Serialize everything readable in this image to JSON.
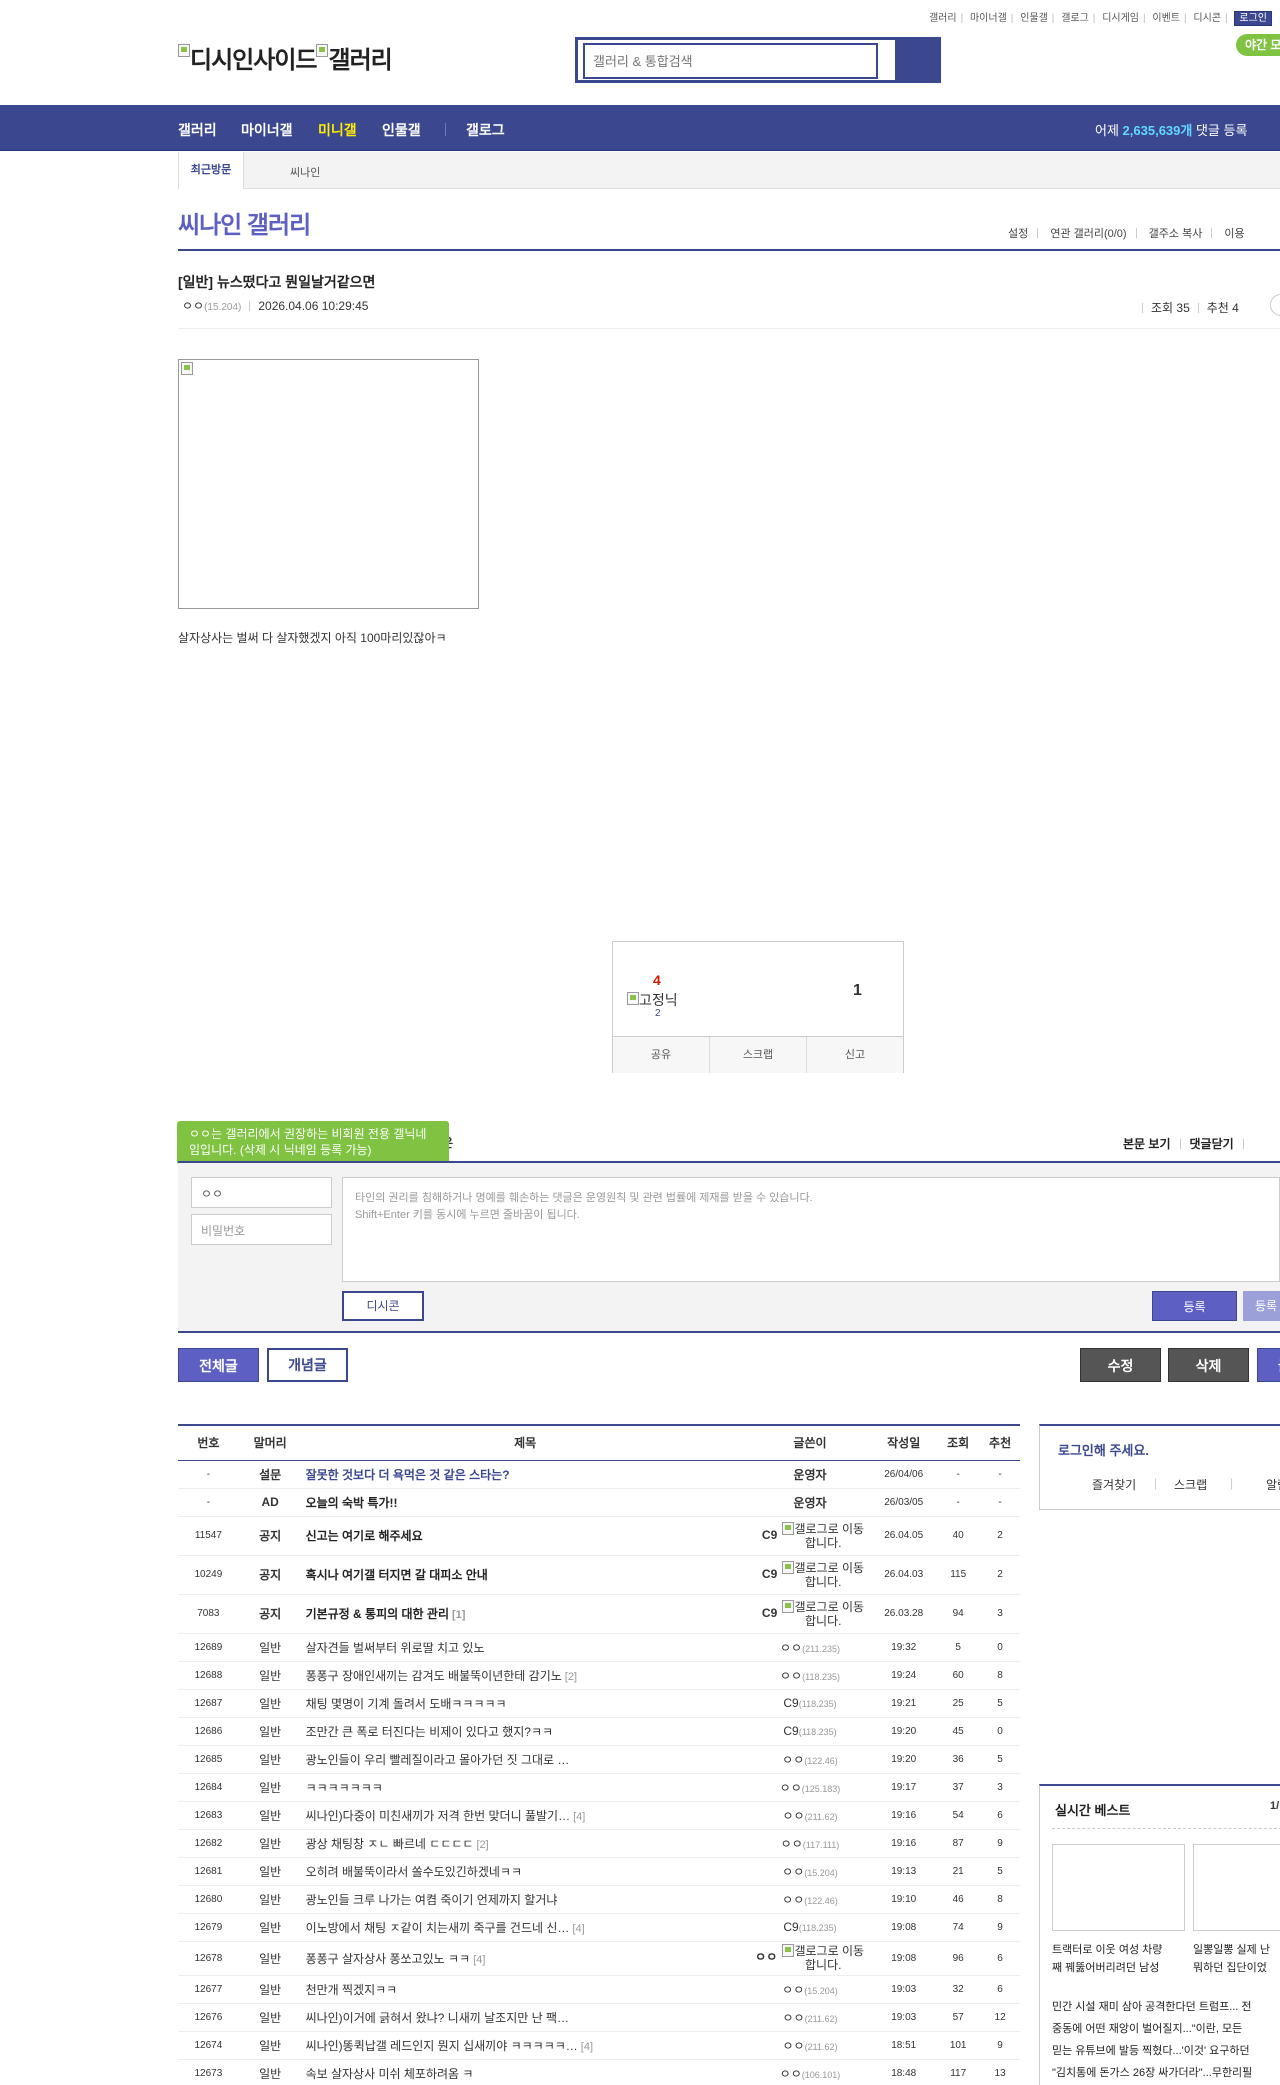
{
  "header": {
    "top_links": [
      "갤러리",
      "마이너갤",
      "인물갤",
      "갤로그",
      "디시게임",
      "이벤트",
      "디시콘"
    ],
    "login": "로그인",
    "logo_alt_1": "디시인사이드",
    "logo_alt_2": "갤러리",
    "search_placeholder": "갤러리 & 통합검색",
    "night_mode": "야간 모"
  },
  "gnb": {
    "items": [
      "갤러리",
      "마이너갤",
      "미니갤",
      "인물갤",
      "갤로그"
    ],
    "stat_prefix": "어제 ",
    "stat_value": "2,635,639개",
    "stat_suffix": " 댓글 등록"
  },
  "colors": {
    "brand": "#3b4890",
    "accent": "#5d5fc2",
    "active": "#ffed00",
    "green": "#80c342"
  },
  "recent": {
    "label": "최근방문",
    "items": [
      "씨나인"
    ]
  },
  "gallery": {
    "title": "씨나인 갤러리",
    "menu": [
      "설정",
      "연관 갤러리(0/0)",
      "갤주소 복사",
      "이용"
    ]
  },
  "post": {
    "title": "[일반] 뉴스떴다고 뭔일날거같으면",
    "author": "ㅇㅇ",
    "ip": "(15.204)",
    "datetime": "2026.04.06 10:29:45",
    "views_label": "조회 35",
    "recommend_label": "추천 4",
    "body": "살자상사는 벌써 다 살자했겠지 아직 100마리있잖아ㅋ",
    "upvotes": "4",
    "fixed_nick_alt": "고정닉",
    "fixed_count": "2",
    "downvotes": "1",
    "actions": [
      "공유",
      "스크랩",
      "신고"
    ]
  },
  "comment": {
    "tooltip": "ㅇㅇ는 갤러리에서 권장하는 비회원 전용 갤닉네임입니다. (삭제 시 닉네임 등록 가능)",
    "label": "은",
    "menu": [
      "본문 보기",
      "댓글닫기"
    ],
    "nick_value": "ㅇㅇ",
    "password_placeholder": "비밀번호",
    "textarea_line1": "타인의 권리를 침해하거나 명예를 훼손하는 댓글은 운영원칙 및 관련 법률에 제재를 받을 수 있습니다.",
    "textarea_line2": "Shift+Enter 키를 동시에 누르면 줄바꿈이 됩니다.",
    "dccon": "디시콘",
    "submit": "등록",
    "submit2": "등록"
  },
  "list_buttons": {
    "all": "전체글",
    "concept": "개념글",
    "edit": "수정",
    "delete": "삭제",
    "write": "글"
  },
  "list": {
    "headers": [
      "번호",
      "말머리",
      "제목",
      "글쓴이",
      "작성일",
      "조회",
      "추천"
    ],
    "rows": [
      {
        "num": "-",
        "head": "설문",
        "title": "잘못한 것보다 더 욕먹은 것 같은 스타는?",
        "cmt": "",
        "writer": "운영자",
        "ip": "",
        "date": "26/04/06",
        "views": "-",
        "rec": "-",
        "type": "survey"
      },
      {
        "num": "-",
        "head": "AD",
        "title": "오늘의 숙박 특가!!",
        "cmt": "",
        "writer": "운영자",
        "ip": "",
        "date": "26/03/05",
        "views": "-",
        "rec": "-",
        "type": "ad"
      },
      {
        "num": "11547",
        "head": "공지",
        "title": "신고는 여기로 해주세요",
        "cmt": "",
        "writer": "C9",
        "ip": "",
        "date": "26.04.05",
        "views": "40",
        "rec": "2",
        "type": "notice"
      },
      {
        "num": "10249",
        "head": "공지",
        "title": "혹시나 여기갤 터지면 갈 대피소 안내",
        "cmt": "",
        "writer": "C9",
        "ip": "",
        "date": "26.04.03",
        "views": "115",
        "rec": "2",
        "type": "notice"
      },
      {
        "num": "7083",
        "head": "공지",
        "title": "기본규정 & 통피의 대한 관리",
        "cmt": "[1]",
        "writer": "C9",
        "ip": "",
        "date": "26.03.28",
        "views": "94",
        "rec": "3",
        "type": "notice"
      },
      {
        "num": "12689",
        "head": "일반",
        "title": "살자견들 벌써부터 위로딸 치고 있노",
        "cmt": "",
        "writer": "ㅇㅇ",
        "ip": "(211.235)",
        "date": "19:32",
        "views": "5",
        "rec": "0",
        "type": "normal"
      },
      {
        "num": "12688",
        "head": "일반",
        "title": "퐁퐁구 장애인새끼는 감겨도 배불뚝이년한테 감기노",
        "cmt": "[2]",
        "writer": "ㅇㅇ",
        "ip": "(118.235)",
        "date": "19:24",
        "views": "60",
        "rec": "8",
        "type": "normal"
      },
      {
        "num": "12687",
        "head": "일반",
        "title": "채팅 몇명이 기계 돌려서 도배ㅋㅋㅋㅋㅋ",
        "cmt": "",
        "writer": "C9",
        "ip": "(118.235)",
        "date": "19:21",
        "views": "25",
        "rec": "5",
        "type": "normal"
      },
      {
        "num": "12686",
        "head": "일반",
        "title": "조만간 큰 폭로 터진다는 비제이 있다고 했지?ㅋㅋ",
        "cmt": "",
        "writer": "C9",
        "ip": "(118.235)",
        "date": "19:20",
        "views": "45",
        "rec": "0",
        "type": "normal"
      },
      {
        "num": "12685",
        "head": "일반",
        "title": "광노인들이 우리 빨레질이라고 몰아가던 짓 그대로 …",
        "cmt": "",
        "writer": "ㅇㅇ",
        "ip": "(122.46)",
        "date": "19:20",
        "views": "36",
        "rec": "5",
        "type": "normal"
      },
      {
        "num": "12684",
        "head": "일반",
        "title": "ㅋㅋㅋㅋㅋㅋㅋ",
        "cmt": "",
        "writer": "ㅇㅇ",
        "ip": "(125.183)",
        "date": "19:17",
        "views": "37",
        "rec": "3",
        "type": "normal"
      },
      {
        "num": "12683",
        "head": "일반",
        "title": "씨나인)다중이 미친새끼가 저격 한번 맞더니 풀발기…",
        "cmt": "[4]",
        "writer": "ㅇㅇ",
        "ip": "(211.62)",
        "date": "19:16",
        "views": "54",
        "rec": "6",
        "type": "normal"
      },
      {
        "num": "12682",
        "head": "일반",
        "title": "광상 채팅창 ㅈㄴ 빠르네 ㄷㄷㄷㄷ",
        "cmt": "[2]",
        "writer": "ㅇㅇ",
        "ip": "(117.111)",
        "date": "19:16",
        "views": "87",
        "rec": "9",
        "type": "normal"
      },
      {
        "num": "12681",
        "head": "일반",
        "title": "오히려 배불뚝이라서 쏠수도있긴하겠네ㅋㅋ",
        "cmt": "",
        "writer": "ㅇㅇ",
        "ip": "(15.204)",
        "date": "19:13",
        "views": "21",
        "rec": "5",
        "type": "normal"
      },
      {
        "num": "12680",
        "head": "일반",
        "title": "광노인들 크루 나가는 여켬 죽이기 언제까지 할거냐",
        "cmt": "",
        "writer": "ㅇㅇ",
        "ip": "(122.46)",
        "date": "19:10",
        "views": "46",
        "rec": "8",
        "type": "normal"
      },
      {
        "num": "12679",
        "head": "일반",
        "title": "이노방에서 채팅 ㅈ같이 치는새끼 죽구를 건드네 신…",
        "cmt": "[4]",
        "writer": "C9",
        "ip": "(118.235)",
        "date": "19:08",
        "views": "74",
        "rec": "9",
        "type": "normal"
      },
      {
        "num": "12678",
        "head": "일반",
        "title": "퐁퐁구 살자상사 퐁쏘고있노 ㅋㅋ",
        "cmt": "[4]",
        "writer": "ㅇㅇ",
        "ip": "",
        "date": "19:08",
        "views": "96",
        "rec": "6",
        "type": "gallog"
      },
      {
        "num": "12677",
        "head": "일반",
        "title": "천만개 찍겠지ㅋㅋ",
        "cmt": "",
        "writer": "ㅇㅇ",
        "ip": "(15.204)",
        "date": "19:03",
        "views": "32",
        "rec": "6",
        "type": "normal"
      },
      {
        "num": "12676",
        "head": "일반",
        "title": "씨나인)이거에 긁혀서 왔냐? 니새끼 날조지만 난 팩…",
        "cmt": "",
        "writer": "ㅇㅇ",
        "ip": "(211.62)",
        "date": "19:03",
        "views": "57",
        "rec": "12",
        "type": "normal"
      },
      {
        "num": "12674",
        "head": "일반",
        "title": "씨나인)똥퀵납갤 레드인지 뭔지 십새끼야 ㅋㅋㅋㅋㅋ…",
        "cmt": "[4]",
        "writer": "ㅇㅇ",
        "ip": "(211.62)",
        "date": "18:51",
        "views": "101",
        "rec": "9",
        "type": "normal"
      },
      {
        "num": "12673",
        "head": "일반",
        "title": "속보 살자상사 미쉬 체포하려옴 ㅋ",
        "cmt": "",
        "writer": "ㅇㅇ",
        "ip": "(106.101)",
        "date": "18:48",
        "views": "117",
        "rec": "13",
        "type": "normal"
      }
    ],
    "gallog_alt": "갤로그로 이동합니다."
  },
  "sidebar": {
    "login_title": "로그인해 주세요.",
    "login_menu": [
      "즐겨찾기",
      "스크랩",
      "알림"
    ],
    "best_title": "실시간 베스트",
    "best_page": "1/",
    "best_captions": [
      [
        "트랙터로 이웃 여성 차량",
        "째 꿰뚫어버리려던 남성"
      ],
      [
        "일뽕일뽕 실제 난",
        "뭐하던 집단이었"
      ]
    ],
    "best_news": [
      "민간 시설 재미 삼아 공격한다던 트럼프... 전",
      "중동에 어떤 재앙이 벌어질지...\"이란, 모든",
      "믿는 유튜브에 발등 찍혔다...'이것' 요구하던",
      "\"김치통에 돈가스 26장 싸가더라\"...무한리필"
    ]
  }
}
